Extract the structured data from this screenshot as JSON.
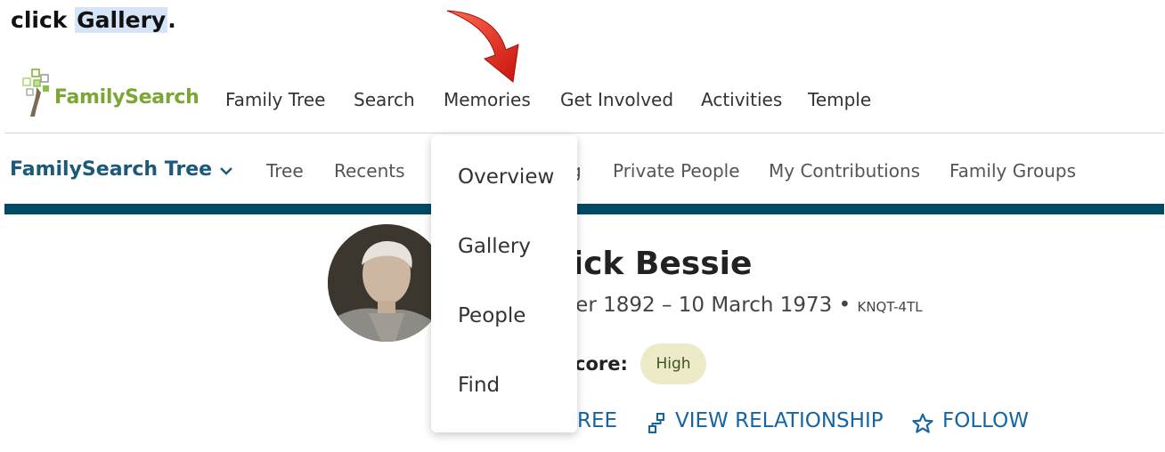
{
  "instruction": {
    "prefix": "click ",
    "target": "Gallery",
    "suffix": "."
  },
  "logo": {
    "text": "FamilySearch"
  },
  "top_nav": [
    "Family Tree",
    "Search",
    "Memories",
    "Get Involved",
    "Activities",
    "Temple"
  ],
  "sub_nav": {
    "title": "FamilySearch Tree",
    "items": [
      "Tree",
      "Recents",
      "g",
      "Private People",
      "My Contributions",
      "Family Groups"
    ]
  },
  "memories_menu": [
    "Overview",
    "Gallery",
    "People",
    "Find"
  ],
  "person": {
    "name": "rick Bessie",
    "dates": "nber 1892 – 10 March 1973",
    "separator": " • ",
    "pid": "KNQT-4TL",
    "score_label": "core:",
    "score_value": "High"
  },
  "actions": {
    "tree": "REE",
    "view_relationship": "VIEW RELATIONSHIP",
    "follow": "FOLLOW"
  },
  "colors": {
    "brand_green": "#7ba534",
    "sub_nav_title": "#1b5a7a",
    "teal_bar": "#004a66",
    "action_blue": "#1565a4",
    "badge_bg": "#eceac7",
    "arrow_red": "#e4211b",
    "highlight": "#d6e4f7"
  },
  "icons": [
    "red-arrow-icon",
    "tree-logo-icon",
    "chevron-down-icon",
    "relationship-icon",
    "star-icon"
  ]
}
